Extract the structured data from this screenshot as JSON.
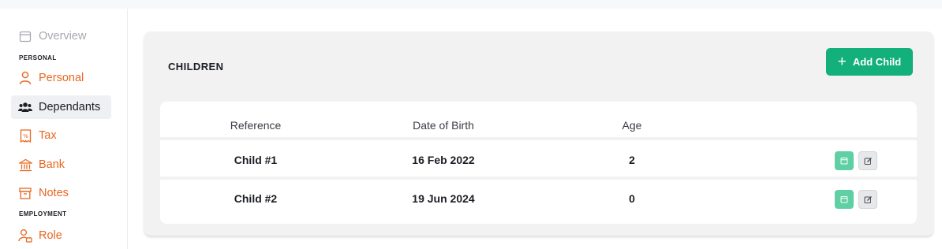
{
  "sidebar": {
    "items": [
      {
        "label": "Overview",
        "icon": "calendar-icon"
      },
      {
        "label": "Personal",
        "icon": "person-icon"
      },
      {
        "label": "Dependants",
        "icon": "people-icon"
      },
      {
        "label": "Tax",
        "icon": "receipt-icon"
      },
      {
        "label": "Bank",
        "icon": "bank-icon"
      },
      {
        "label": "Notes",
        "icon": "archive-icon"
      },
      {
        "label": "Role",
        "icon": "user-briefcase-icon"
      }
    ],
    "sections": {
      "personal": "PERSONAL",
      "employment": "EMPLOYMENT"
    }
  },
  "children_card": {
    "title": "CHILDREN",
    "add_button_label": "Add Child",
    "columns": [
      "Reference",
      "Date of Birth",
      "Age"
    ],
    "rows": [
      {
        "reference": "Child #1",
        "dob": "16 Feb 2022",
        "age": "2"
      },
      {
        "reference": "Child #2",
        "dob": "19 Jun 2024",
        "age": "0"
      }
    ]
  },
  "colors": {
    "accent": "#e8671f",
    "primary_green": "#13b07b",
    "view_green": "#5fd0a4"
  }
}
